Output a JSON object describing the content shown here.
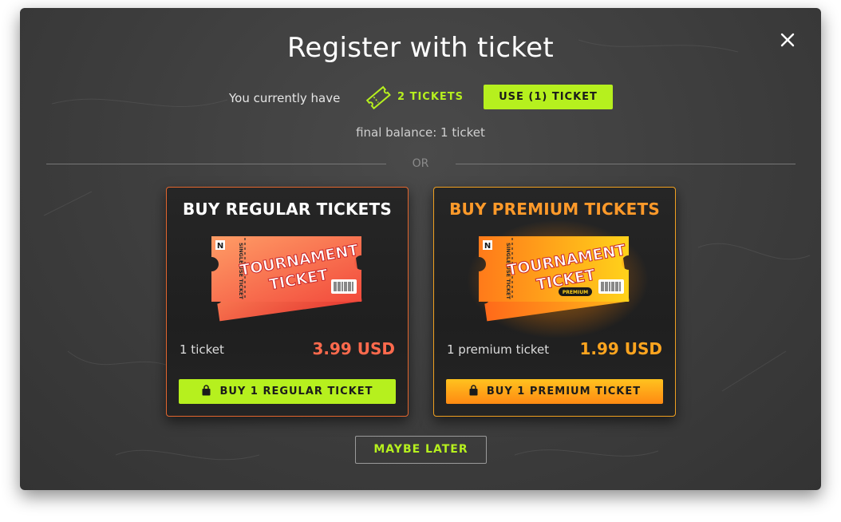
{
  "modal": {
    "title": "Register with ticket",
    "current_label": "You currently have",
    "tickets_count": "2 TICKETS",
    "use_button": "USE (1) TICKET",
    "final_balance": "final balance: 1 ticket",
    "or": "OR",
    "maybe_later": "MAYBE LATER"
  },
  "cards": {
    "regular": {
      "title": "BUY REGULAR TICKETS",
      "qty": "1 ticket",
      "price": "3.99 USD",
      "button": "BUY 1 REGULAR TICKET"
    },
    "premium": {
      "title": "BUY PREMIUM TICKETS",
      "qty": "1 premium ticket",
      "price": "1.99 USD",
      "button": "BUY 1 PREMIUM TICKET"
    }
  },
  "ticket_art": {
    "brand": "N",
    "side_text": "SINGLE USE TICKET",
    "line1": "TOURNAMENT",
    "line2": "TICKET",
    "premium_tag": "PREMIUM"
  },
  "colors": {
    "accent_green": "#b6f01e",
    "regular_price": "#ff6a4d",
    "premium_orange": "#ffa51f",
    "background": "#3d3d3d"
  },
  "icons": {
    "close": "close-icon",
    "ticket": "ticket-icon",
    "bag": "shopping-bag-icon"
  }
}
